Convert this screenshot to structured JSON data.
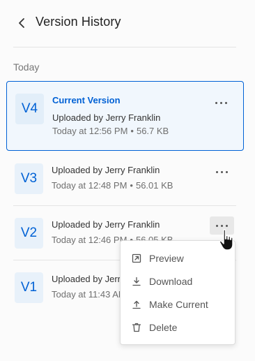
{
  "header": {
    "title": "Version History",
    "back_icon": "chevron-left-icon"
  },
  "section": {
    "label": "Today"
  },
  "versions": [
    {
      "badge": "V4",
      "status": "Current Version",
      "uploader": "Uploaded by Jerry Franklin",
      "time": "Today at 12:56 PM",
      "size": "56.7 KB",
      "separator": "•",
      "current": true
    },
    {
      "badge": "V3",
      "status": "",
      "uploader": "Uploaded by Jerry Franklin",
      "time": "Today at 12:48 PM",
      "size": "56.01 KB",
      "separator": "•",
      "current": false
    },
    {
      "badge": "V2",
      "status": "",
      "uploader": "Uploaded by Jerry Franklin",
      "time": "Today at 12:46 PM",
      "size": "56.05 KB",
      "separator": "•",
      "current": false
    },
    {
      "badge": "V1",
      "status": "",
      "uploader": "Uploaded by Jerry Franklin",
      "time": "Today at 11:43 AM",
      "size": "",
      "separator": "•",
      "current": false
    }
  ],
  "menu": {
    "items": [
      {
        "label": "Preview",
        "icon": "open-external-icon"
      },
      {
        "label": "Download",
        "icon": "download-icon"
      },
      {
        "label": "Make Current",
        "icon": "upload-icon"
      },
      {
        "label": "Delete",
        "icon": "trash-icon"
      }
    ]
  },
  "colors": {
    "accent": "#0061d5",
    "current_bg": "#f1f7fd",
    "badge_bg": "#e8f1fa"
  }
}
